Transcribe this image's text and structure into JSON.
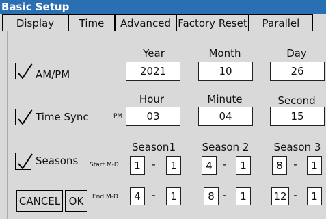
{
  "window": {
    "title": "Basic Setup"
  },
  "tabs": [
    {
      "label": "Display",
      "active": false
    },
    {
      "label": "Time",
      "active": true
    },
    {
      "label": "Advanced",
      "active": false
    },
    {
      "label": "Factory Reset",
      "active": false
    },
    {
      "label": "Parallel",
      "active": false
    }
  ],
  "date": {
    "year_label": "Year",
    "year": "2021",
    "month_label": "Month",
    "month": "10",
    "day_label": "Day",
    "day": "26"
  },
  "time": {
    "hour_label": "Hour",
    "hour": "03",
    "ampm": "PM",
    "minute_label": "Minute",
    "minute": "04",
    "second_label": "Second",
    "second": "15"
  },
  "options": {
    "ampm": {
      "label": "AM/PM",
      "checked": true
    },
    "timesync": {
      "label": "Time Sync",
      "checked": true
    },
    "seasons": {
      "label": "Seasons",
      "checked": true
    }
  },
  "seasons": {
    "start_label": "Start M-D",
    "end_label": "End M-D",
    "dash": "-",
    "list": [
      {
        "name": "Season1",
        "start_m": "1",
        "start_d": "1",
        "end_m": "4",
        "end_d": "1"
      },
      {
        "name": "Season 2",
        "start_m": "4",
        "start_d": "1",
        "end_m": "8",
        "end_d": "1"
      },
      {
        "name": "Season 3",
        "start_m": "8",
        "start_d": "1",
        "end_m": "12",
        "end_d": "1"
      }
    ]
  },
  "buttons": {
    "cancel": "CANCEL",
    "ok": "OK"
  }
}
